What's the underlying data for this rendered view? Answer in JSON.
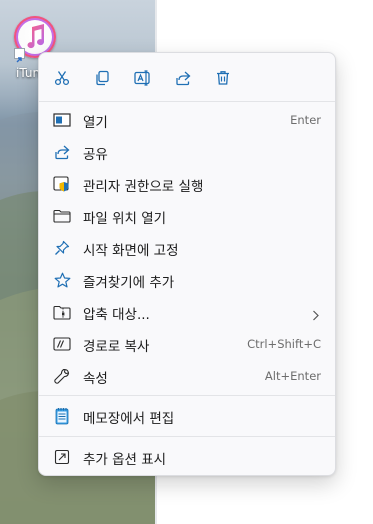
{
  "desktop": {
    "icon_label": "iTunes"
  },
  "toolbar": {
    "buttons": [
      {
        "name": "cut",
        "icon": "scissors-icon"
      },
      {
        "name": "copy",
        "icon": "copy-icon"
      },
      {
        "name": "rename",
        "icon": "rename-icon"
      },
      {
        "name": "share",
        "icon": "share-icon"
      },
      {
        "name": "delete",
        "icon": "trash-icon"
      }
    ]
  },
  "menu": {
    "items": [
      {
        "label": "열기",
        "shortcut": "Enter",
        "icon": "open-app-icon"
      },
      {
        "label": "공유",
        "shortcut": "",
        "icon": "share-icon"
      },
      {
        "label": "관리자 권한으로 실행",
        "shortcut": "",
        "icon": "shield-icon"
      },
      {
        "label": "파일 위치 열기",
        "shortcut": "",
        "icon": "folder-icon"
      },
      {
        "label": "시작 화면에 고정",
        "shortcut": "",
        "icon": "pin-icon"
      },
      {
        "label": "즐겨찾기에 추가",
        "shortcut": "",
        "icon": "star-icon"
      },
      {
        "label": "압축 대상...",
        "shortcut": "",
        "icon": "zip-folder-icon",
        "submenu": true
      },
      {
        "label": "경로로 복사",
        "shortcut": "Ctrl+Shift+C",
        "icon": "copy-path-icon"
      },
      {
        "label": "속성",
        "shortcut": "Alt+Enter",
        "icon": "wrench-icon"
      },
      {
        "label": "메모장에서 편집",
        "shortcut": "",
        "icon": "notepad-icon"
      },
      {
        "label": "추가 옵션 표시",
        "shortcut": "",
        "icon": "more-options-icon"
      }
    ]
  },
  "colors": {
    "menu_bg": "#f9f9fb",
    "accent": "#0f6cbd",
    "text": "#1b1b1b",
    "shortcut_text": "#6d6d6d"
  }
}
